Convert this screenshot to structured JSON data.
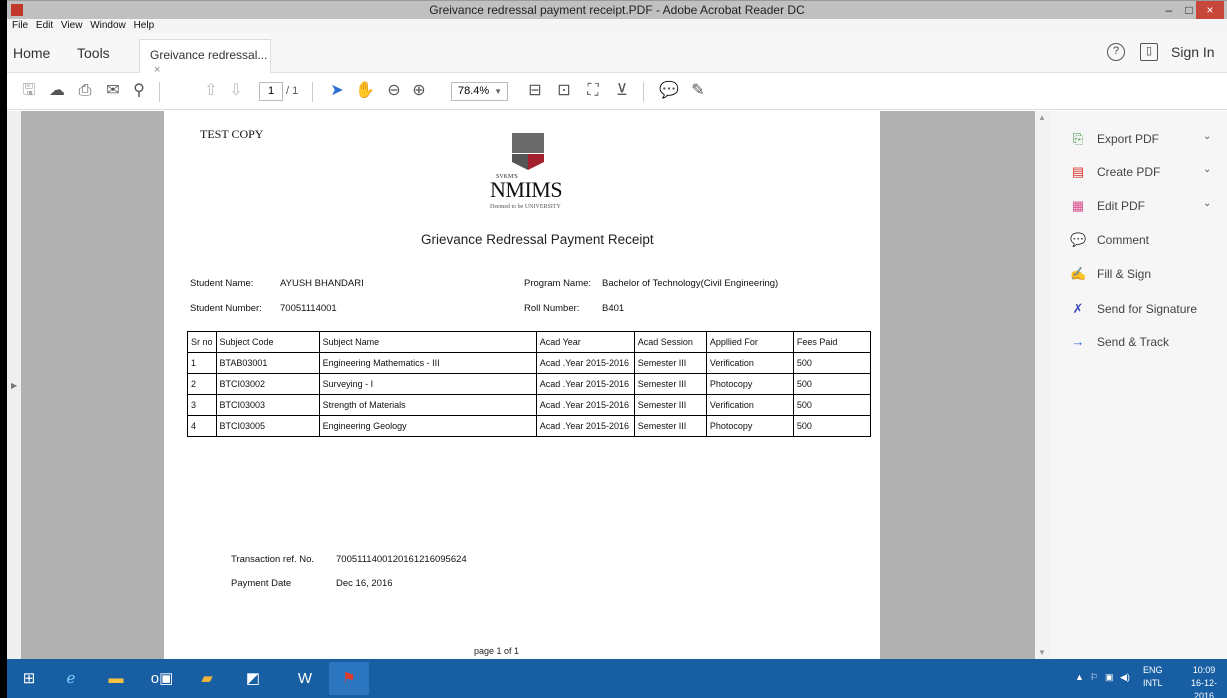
{
  "window": {
    "title": "Greivance redressal payment receipt.PDF - Adobe Acrobat Reader DC",
    "min": "–",
    "max": "□",
    "close": "×"
  },
  "menu": [
    "File",
    "Edit",
    "View",
    "Window",
    "Help"
  ],
  "tabs": {
    "home": "Home",
    "tools": "Tools",
    "doc": "Greivance redressal...",
    "doc_close": "×",
    "sign_in": "Sign In"
  },
  "toolbar": {
    "page_current": "1",
    "page_total": "/ 1",
    "zoom": "78.4%"
  },
  "document": {
    "test_copy": "TEST COPY",
    "logo": {
      "svkm": "SVKM'S",
      "name": "NMIMS",
      "tagline": "Deemed to be UNIVERSITY"
    },
    "title": "Grievance Redressal Payment Receipt",
    "student_name_label": "Student Name:",
    "student_name": "AYUSH BHANDARI",
    "program_name_label": "Program Name:",
    "program_name": "Bachelor of Technology(Civil Engineering)",
    "student_number_label": "Student Number:",
    "student_number": "70051114001",
    "roll_number_label": "Roll Number:",
    "roll_number": "B401",
    "table": {
      "headers": [
        "Sr no",
        "Subject Code",
        "Subject  Name",
        "Acad Year",
        "Acad Session",
        "Appllied For",
        "Fees Paid"
      ],
      "rows": [
        [
          "1",
          "BTAB03001",
          "Engineering Mathematics - III",
          "Acad .Year 2015-2016",
          "Semester III",
          "Verification",
          "500"
        ],
        [
          "2",
          "BTCI03002",
          "Surveying - I",
          "Acad .Year 2015-2016",
          "Semester III",
          "Photocopy",
          "500"
        ],
        [
          "3",
          "BTCI03003",
          "Strength of Materials",
          "Acad .Year 2015-2016",
          "Semester III",
          "Verification",
          "500"
        ],
        [
          "4",
          "BTCI03005",
          "Engineering Geology",
          "Acad .Year 2015-2016",
          "Semester III",
          "Photocopy",
          "500"
        ]
      ]
    },
    "txn_label": "Transaction ref. No.",
    "txn_value": "7005111400120161216095624",
    "date_label": "Payment Date",
    "date_value": "Dec 16, 2016",
    "footer": "page 1 of 1"
  },
  "right_pane": {
    "items": [
      {
        "label": "Export PDF",
        "color": "#3a8a3a",
        "icon": "export-pdf-icon"
      },
      {
        "label": "Create PDF",
        "color": "#d9342b",
        "icon": "create-pdf-icon"
      },
      {
        "label": "Edit PDF",
        "color": "#d74a8c",
        "icon": "edit-pdf-icon"
      },
      {
        "label": "Comment",
        "color": "#e8b800",
        "icon": "comment-icon"
      },
      {
        "label": "Fill & Sign",
        "color": "#6a4bbf",
        "icon": "fill-sign-icon"
      },
      {
        "label": "Send for Signature",
        "color": "#3a4fbf",
        "icon": "send-signature-icon"
      },
      {
        "label": "Send & Track",
        "color": "#2a6fd6",
        "icon": "send-track-icon"
      }
    ]
  },
  "taskbar": {
    "lang_top": "ENG",
    "lang_bottom": "INTL",
    "time": "10:09",
    "date": "16-12-2016"
  }
}
